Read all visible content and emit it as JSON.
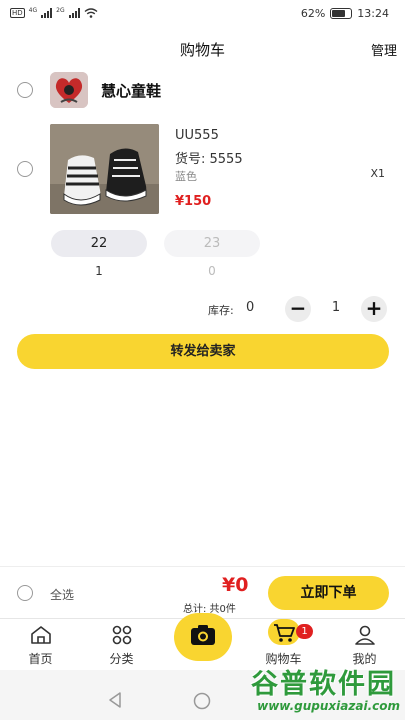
{
  "status_bar": {
    "hd": "HD",
    "net1": "4G",
    "net2": "2G",
    "battery": "62%",
    "time": "13:24"
  },
  "header": {
    "title": "购物车",
    "manage": "管理"
  },
  "shop": {
    "name": "慧心童鞋"
  },
  "product": {
    "name": "UU555",
    "code": "货号:  5555",
    "color": "蓝色",
    "qty": "X1",
    "price": "¥150",
    "sizes": [
      {
        "size": "22",
        "count": "1",
        "selected": true
      },
      {
        "size": "23",
        "count": "0",
        "selected": false
      }
    ],
    "stock_label": "库存:",
    "stock_value": "0",
    "stepper_value": "1",
    "minus": "−",
    "plus": "+"
  },
  "forward_button": "转发给卖家",
  "checkout": {
    "select_all": "全选",
    "total_amount": "¥0",
    "total_label": "总计:  共0件",
    "order_button": "立即下单"
  },
  "tabs": [
    {
      "label": "首页",
      "icon": "home-icon"
    },
    {
      "label": "分类",
      "icon": "grid-icon"
    },
    {
      "label": "",
      "icon": "camera-icon"
    },
    {
      "label": "购物车",
      "icon": "cart-icon",
      "badge": "1"
    },
    {
      "label": "我的",
      "icon": "person-icon"
    }
  ],
  "watermark": {
    "title": "谷普软件园",
    "url": "www.gupuxiazai.com"
  },
  "colors": {
    "accent_yellow": "#f9d530",
    "price_red": "#e02020",
    "watermark_green": "#2f9a3c"
  }
}
